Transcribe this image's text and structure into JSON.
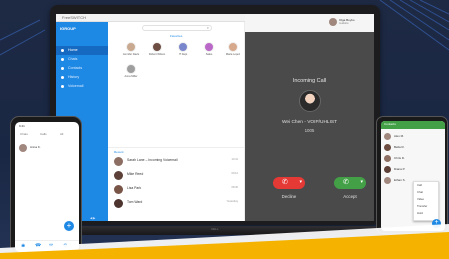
{
  "desktop_app": {
    "title_bar": {
      "app_name": "FreeSWITCH",
      "window_buttons": "─ ▢ ✕"
    },
    "sidebar": {
      "brand": "IGROUP",
      "nav": [
        {
          "label": "Home",
          "active": true
        },
        {
          "label": "Chats",
          "active": false
        },
        {
          "label": "Contacts",
          "active": false
        },
        {
          "label": "History",
          "active": false
        },
        {
          "label": "Voicemail",
          "active": false
        }
      ],
      "footer": "◀ ▶"
    },
    "contacts": {
      "section_label": "Favorites",
      "items": [
        {
          "name": "Jennifer Davis"
        },
        {
          "name": "Robert Wilson"
        },
        {
          "name": "IT Dept"
        },
        {
          "name": "Sales"
        },
        {
          "name": "Maria Lopez"
        },
        {
          "name": "Anna Miller"
        }
      ]
    },
    "history": {
      "section_label": "Recent",
      "items": [
        {
          "name": "Sarah Lane – Incoming Voicemail",
          "time": "10:41"
        },
        {
          "name": "Mike Reed",
          "time": "09:12"
        },
        {
          "name": "Lisa Park",
          "time": "08:30"
        },
        {
          "name": "Tom Ward",
          "time": "Yesterday"
        }
      ]
    },
    "call": {
      "self_name": "Olga Boyko",
      "self_status": "Available",
      "title": "Incoming Call",
      "caller_name": "Wei Chen - VOIP/UHLIST",
      "caller_number": "1005",
      "decline_label": "Decline",
      "accept_label": "Accept",
      "decline_icon": "phone-hangup-icon",
      "accept_icon": "phone-icon"
    },
    "laptop_brand": "DELL"
  },
  "phone_left": {
    "status": "9:41",
    "tabs": [
      "Chats",
      "Calls",
      "All"
    ],
    "items": [
      {
        "name": "Anna K."
      }
    ],
    "fab": "+",
    "nav_icons": [
      "◉",
      "☎",
      "✉",
      "⚙"
    ]
  },
  "phone_right": {
    "header": "Contacts",
    "rows": [
      {
        "name": "Alex M."
      },
      {
        "name": "Bella R."
      },
      {
        "name": "Chris D."
      },
      {
        "name": "Diana P."
      },
      {
        "name": "Ethan S."
      }
    ],
    "menu": [
      "Call",
      "Chat",
      "Video",
      "Transfer",
      "Hold"
    ],
    "fab": "+"
  },
  "colors": {
    "accent_blue": "#1e88e5",
    "decline_red": "#e53935",
    "accept_green": "#43a047",
    "call_panel": "#4a4a4a",
    "swoosh": "#f5b300",
    "background": "#1e2a44"
  }
}
